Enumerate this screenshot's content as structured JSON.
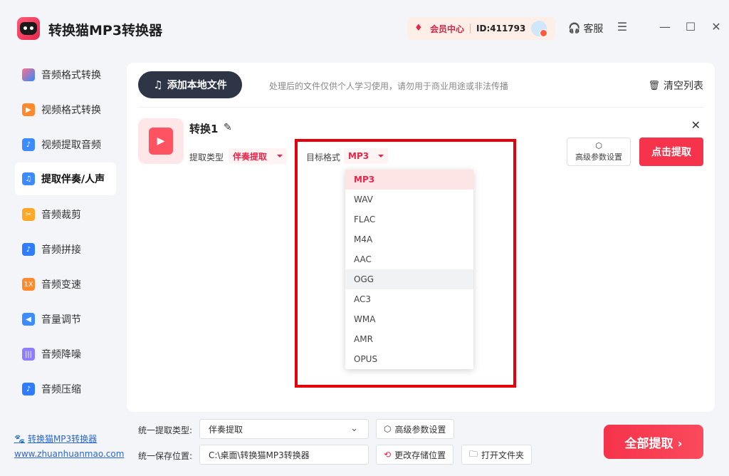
{
  "app": {
    "title": "转换猫MP3转换器",
    "vip_label": "会员中心",
    "user_id": "ID:411793",
    "service_label": "客服",
    "menu_icon": "☰",
    "minimize_icon": "—",
    "maximize_icon": "☐",
    "close_icon": "✕"
  },
  "sidebar": {
    "items": [
      {
        "label": "音频格式转换",
        "icon": "music-convert-icon"
      },
      {
        "label": "视频格式转换",
        "icon": "video-convert-icon"
      },
      {
        "label": "视频提取音频",
        "icon": "video-audio-icon"
      },
      {
        "label": "提取伴奏/人声",
        "icon": "vocal-extract-icon"
      },
      {
        "label": "音频裁剪",
        "icon": "audio-cut-icon"
      },
      {
        "label": "音频拼接",
        "icon": "audio-join-icon"
      },
      {
        "label": "音频变速",
        "icon": "speed-icon"
      },
      {
        "label": "音量调节",
        "icon": "volume-icon"
      },
      {
        "label": "音频降噪",
        "icon": "denoise-icon"
      },
      {
        "label": "音频压缩",
        "icon": "compress-icon"
      }
    ],
    "footer_link": "转换猫MP3转换器",
    "footer_url": "www.zhuanhuanmao.com",
    "speed_glyph": "1X"
  },
  "toolbar": {
    "add_file_label": "添加本地文件",
    "notice": "处理后的文件仅供个人学习使用，请勿用于商业用途或非法传播",
    "clear_label": "清空列表"
  },
  "file": {
    "name": "转换1",
    "extract_type_label": "提取类型",
    "extract_type_value": "伴奏提取",
    "target_format_label": "目标格式",
    "target_format_value": "MP3",
    "advanced_label": "高级参数设置",
    "extract_button": "点击提取"
  },
  "dropdown": {
    "options": [
      "MP3",
      "WAV",
      "FLAC",
      "M4A",
      "AAC",
      "OGG",
      "AC3",
      "WMA",
      "AMR",
      "OPUS"
    ],
    "selected": "MP3",
    "hovered": "OGG"
  },
  "bottom": {
    "unified_type_label": "统一提取类型:",
    "unified_type_value": "伴奏提取",
    "advanced_label": "高级参数设置",
    "save_path_label": "统一保存位置:",
    "save_path_value": "C:\\桌面\\转换猫MP3转换器",
    "change_path_label": "更改存储位置",
    "open_folder_label": "打开文件夹",
    "extract_all_label": "全部提取 ›"
  },
  "colors": {
    "accent": "#f5334b",
    "highlight": "#e6000a",
    "dark_button": "#2d3546"
  }
}
